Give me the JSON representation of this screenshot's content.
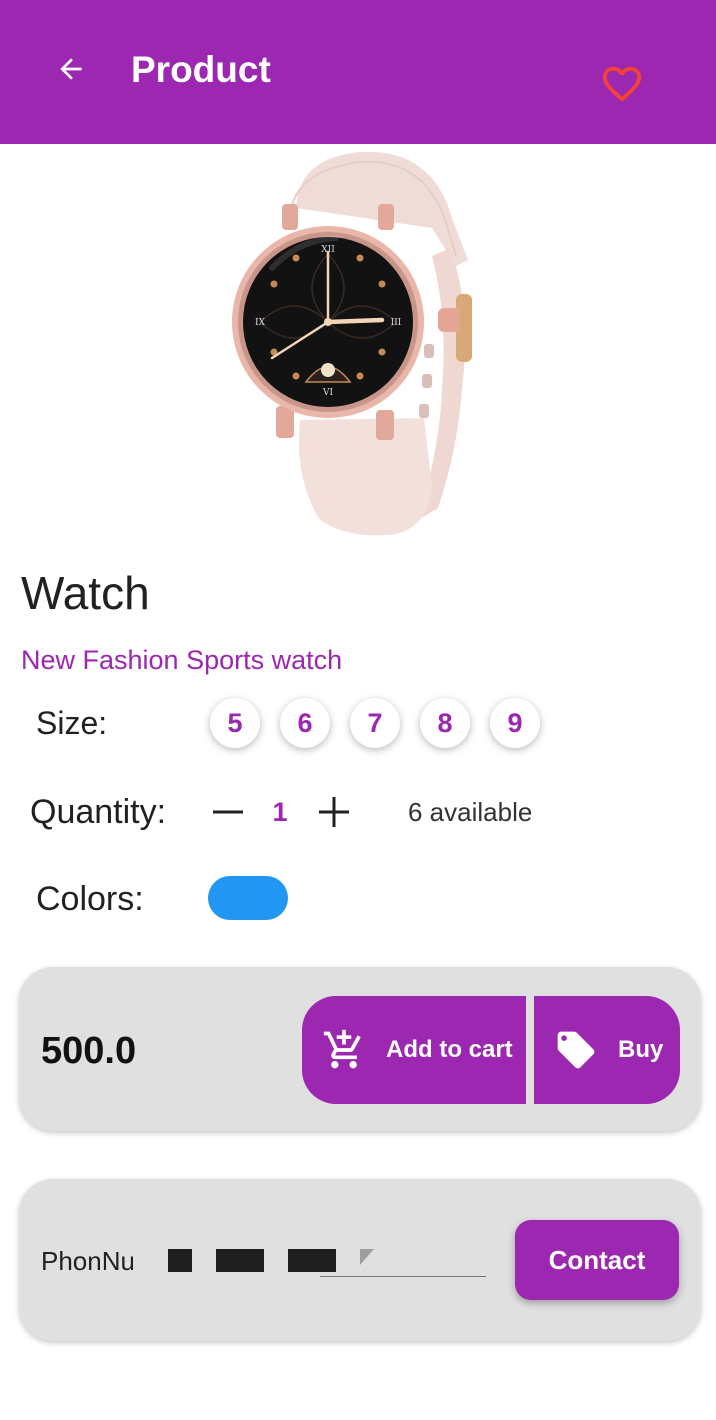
{
  "app_bar": {
    "title": "Product",
    "back_icon": "arrow-left-icon",
    "favorite_icon": "heart-outline-icon",
    "background": "#9c27b0",
    "favorite_color": "#f44336"
  },
  "product": {
    "image_alt": "pink smart watch",
    "name": "Watch",
    "description": "New Fashion Sports watch"
  },
  "size": {
    "label": "Size:",
    "options": [
      "5",
      "6",
      "7",
      "8",
      "9"
    ]
  },
  "quantity": {
    "label": "Quantity:",
    "value": "1",
    "available": "6 available",
    "decrement_icon": "minus-icon",
    "increment_icon": "plus-icon"
  },
  "colors": {
    "label": "Colors:",
    "swatches": [
      "#2196f3"
    ]
  },
  "purchase": {
    "price": "500.0",
    "add_to_cart_label": "Add to cart",
    "add_to_cart_icon": "add-shopping-cart-icon",
    "buy_label": "Buy",
    "buy_icon": "tag-icon",
    "accent": "#9c27b0"
  },
  "contact": {
    "phone_label": "PhonNumber",
    "contact_label": "Contact"
  }
}
